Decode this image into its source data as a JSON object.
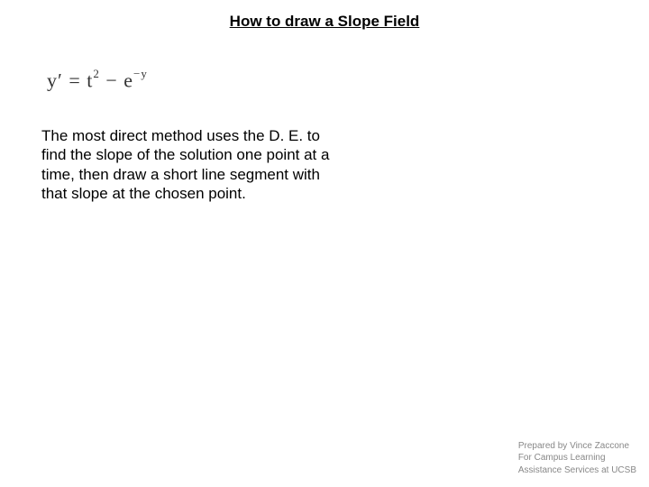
{
  "title": "How to draw a Slope Field",
  "equation": {
    "lhs": "y",
    "prime": "′",
    "eq": " = ",
    "t": "t",
    "t_exp": "2",
    "minus": " − ",
    "e": "e",
    "e_exp": "−y"
  },
  "body": "The most direct method uses the D. E. to find the slope of the solution one point at a time, then draw a short line segment with that slope at the chosen point.",
  "footer": {
    "line1": "Prepared by Vince Zaccone",
    "line2": "For Campus Learning",
    "line3": "Assistance Services at UCSB"
  }
}
